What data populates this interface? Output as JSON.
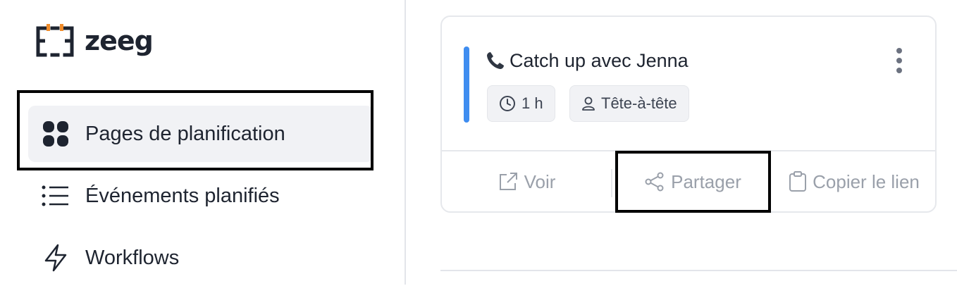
{
  "app": {
    "logo_text": "zeeg"
  },
  "sidebar": {
    "items": [
      {
        "label": "Pages de planification",
        "icon": "grid-icon",
        "active": true
      },
      {
        "label": "Événements planifiés",
        "icon": "list-icon",
        "active": false
      },
      {
        "label": "Workflows",
        "icon": "lightning-icon",
        "active": false
      }
    ]
  },
  "event_card": {
    "title": "Catch up avec Jenna",
    "title_icon": "phone-icon",
    "accent_color": "#3f8df0",
    "chips": [
      {
        "label": "1 h",
        "icon": "clock-icon"
      },
      {
        "label": "Tête-à-tête",
        "icon": "user-icon"
      }
    ],
    "actions": [
      {
        "label": "Voir",
        "icon": "external-link-icon"
      },
      {
        "label": "Partager",
        "icon": "share-icon"
      },
      {
        "label": "Copier le lien",
        "icon": "clipboard-icon"
      }
    ]
  },
  "colors": {
    "text": "#1e2430",
    "muted": "#9aa0aa",
    "active_bg": "#f1f2f5",
    "logo_accent": "#f08c2b"
  }
}
